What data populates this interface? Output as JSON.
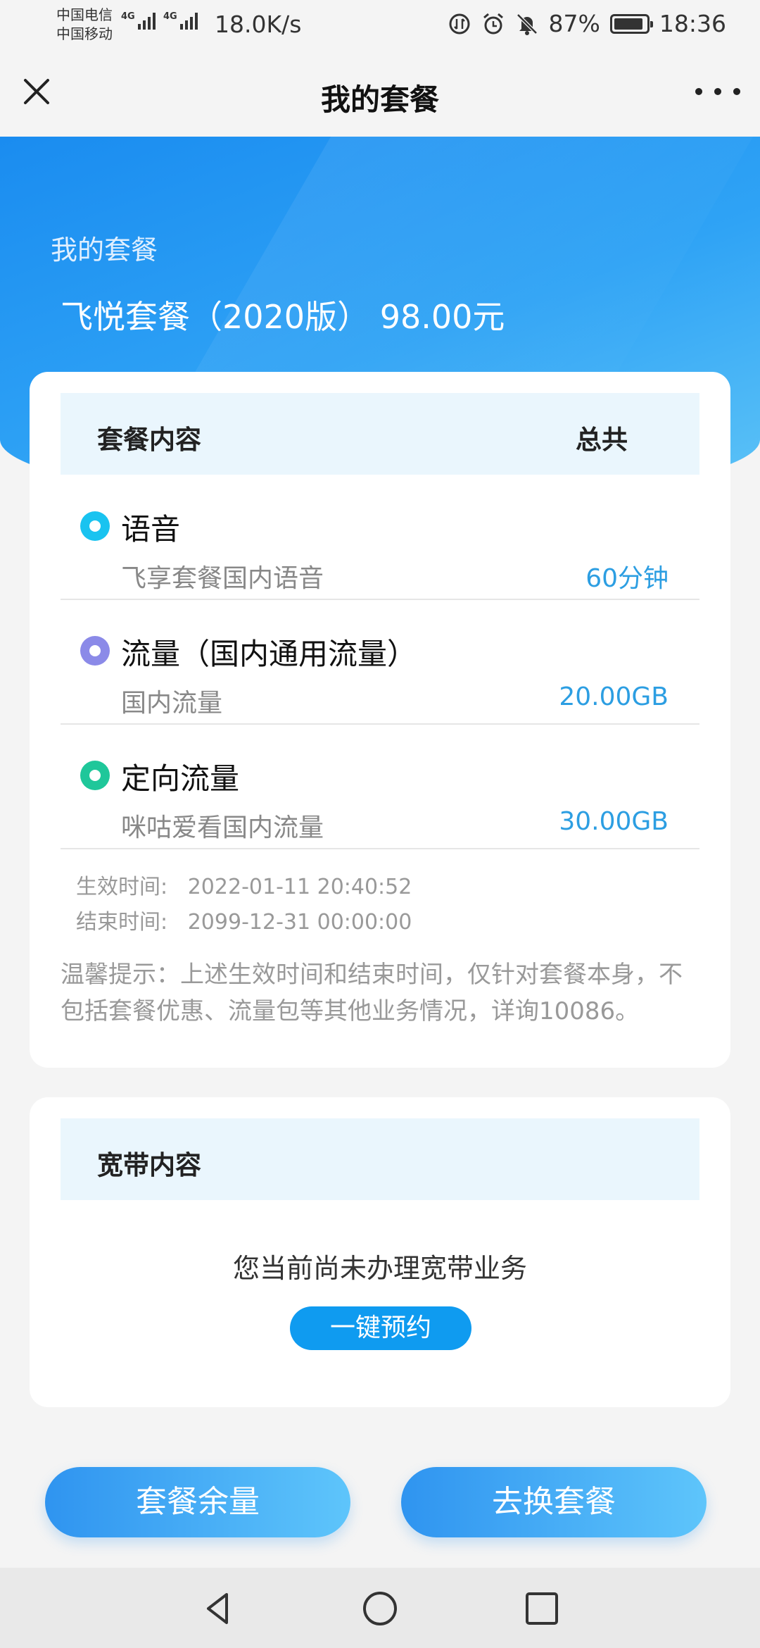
{
  "status_bar": {
    "carrier1": "中国电信",
    "carrier2": "中国移动",
    "net1": "4G",
    "net2": "4G",
    "speed": "18.0K/s",
    "battery": "87%",
    "time": "18:36",
    "icons": [
      "data-saver-icon",
      "alarm-icon",
      "bell-muted-icon",
      "battery-icon"
    ]
  },
  "nav": {
    "title": "我的套餐",
    "close_icon": "close-icon",
    "more_icon": "more-icon"
  },
  "hero": {
    "label": "我的套餐",
    "plan": "飞悦套餐（2020版） 98.00元"
  },
  "plan_card": {
    "header_left": "套餐内容",
    "header_right": "总共",
    "items": [
      {
        "title": "语音",
        "sub": "飞享套餐国内语音",
        "value": "60分钟",
        "color": "#19c3f0"
      },
      {
        "title": "流量（国内通用流量）",
        "sub": "国内流量",
        "value": "20.00GB",
        "color": "#8b8ae8"
      },
      {
        "title": "定向流量",
        "sub": "咪咕爱看国内流量",
        "value": "30.00GB",
        "color": "#1fc79a"
      }
    ],
    "start_label": "生效时间:",
    "start_value": "2022-01-11 20:40:52",
    "end_label": "结束时间:",
    "end_value": "2099-12-31 00:00:00",
    "tip": "温馨提示：上述生效时间和结束时间，仅针对套餐本身，不包括套餐优惠、流量包等其他业务情况，详询10086。"
  },
  "broadband_card": {
    "header": "宽带内容",
    "empty_text": "您当前尚未办理宽带业务",
    "button": "一键预约"
  },
  "bottom_buttons": {
    "left": "套餐余量",
    "right": "去换套餐"
  },
  "system_nav": {
    "back_icon": "back-icon",
    "home_icon": "home-icon",
    "recents_icon": "recents-icon"
  }
}
